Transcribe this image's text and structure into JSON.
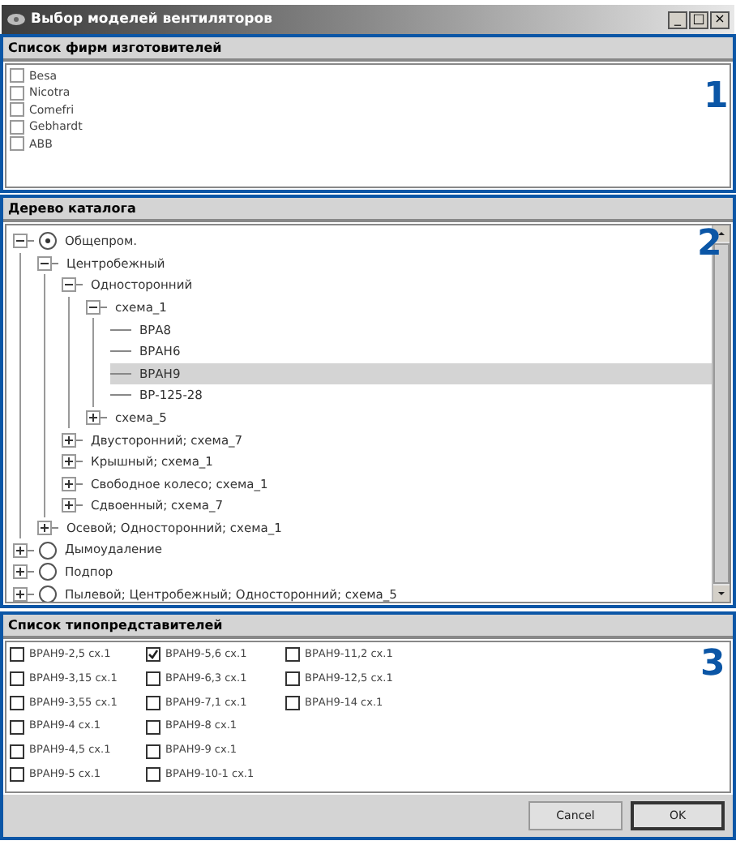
{
  "window": {
    "title": "Выбор моделей вентиляторов",
    "controls": [
      "_",
      "□",
      "×"
    ]
  },
  "manufacturers": {
    "title": "Список фирм изготовителей",
    "marker": "1",
    "items": [
      {
        "label": "Besa",
        "checked": false
      },
      {
        "label": "Nicotra",
        "checked": false
      },
      {
        "label": "Comefri",
        "checked": false
      },
      {
        "label": "Gebhardt",
        "checked": false
      },
      {
        "label": "ABB",
        "checked": false
      }
    ]
  },
  "catalog": {
    "title": "Дерево каталога",
    "marker": "2",
    "tree": [
      {
        "label": "Общепром.",
        "radio": true,
        "selected": false,
        "expanded": true,
        "children": [
          {
            "label": "Центробежный",
            "selected": false,
            "expanded": true,
            "children": [
              {
                "label": "Односторонний",
                "selected": false,
                "expanded": true,
                "children": [
                  {
                    "label": "схема_1",
                    "selected": false,
                    "expanded": true,
                    "children": [
                      {
                        "label": "ВРА8",
                        "selected": false
                      },
                      {
                        "label": "ВРАН6",
                        "selected": false
                      },
                      {
                        "label": "ВРАН9",
                        "selected": true
                      },
                      {
                        "label": "ВР-125-28",
                        "selected": false
                      }
                    ]
                  },
                  {
                    "label": "схема_5",
                    "selected": false,
                    "expanded": false
                  }
                ]
              },
              {
                "label": "Двусторонний; схема_7",
                "selected": false,
                "expanded": false
              },
              {
                "label": "Крышный; схема_1",
                "selected": false,
                "expanded": false
              },
              {
                "label": "Свободное колесо; схема_1",
                "selected": false,
                "expanded": false
              },
              {
                "label": "Сдвоенный; схема_7",
                "selected": false,
                "expanded": false
              }
            ]
          },
          {
            "label": "Осевой; Односторонний; схема_1",
            "selected": false,
            "expanded": false
          }
        ]
      },
      {
        "label": "Дымоудаление",
        "radio": false,
        "selected": false,
        "expanded": false
      },
      {
        "label": "Подпор",
        "radio": false,
        "selected": false,
        "expanded": false
      },
      {
        "label": "Пылевой; Центробежный; Односторонний; схема_5",
        "radio": false,
        "selected": false,
        "expanded": false
      }
    ]
  },
  "models": {
    "title": "Список типопредставителей",
    "marker": "3",
    "items": [
      {
        "label": "ВРАН9-2,5 сх.1",
        "checked": false
      },
      {
        "label": "ВРАН9-3,15 сх.1",
        "checked": false
      },
      {
        "label": "ВРАН9-3,55 сх.1",
        "checked": false
      },
      {
        "label": "ВРАН9-4 сх.1",
        "checked": false
      },
      {
        "label": "ВРАН9-4,5 сх.1",
        "checked": false
      },
      {
        "label": "ВРАН9-5 сх.1",
        "checked": false
      },
      {
        "label": "ВРАН9-5,6 сх.1",
        "checked": true
      },
      {
        "label": "ВРАН9-6,3 сх.1",
        "checked": false
      },
      {
        "label": "ВРАН9-7,1 сх.1",
        "checked": false
      },
      {
        "label": "ВРАН9-8 сх.1",
        "checked": false
      },
      {
        "label": "ВРАН9-9 сх.1",
        "checked": false
      },
      {
        "label": "ВРАН9-10-1 сх.1",
        "checked": false
      },
      {
        "label": "ВРАН9-11,2 сх.1",
        "checked": false
      },
      {
        "label": "ВРАН9-12,5 сх.1",
        "checked": false
      },
      {
        "label": "ВРАН9-14 сх.1",
        "checked": false
      }
    ]
  },
  "buttons": [
    {
      "label": "Cancel",
      "default": false
    },
    {
      "label": "OK",
      "default": true
    }
  ]
}
